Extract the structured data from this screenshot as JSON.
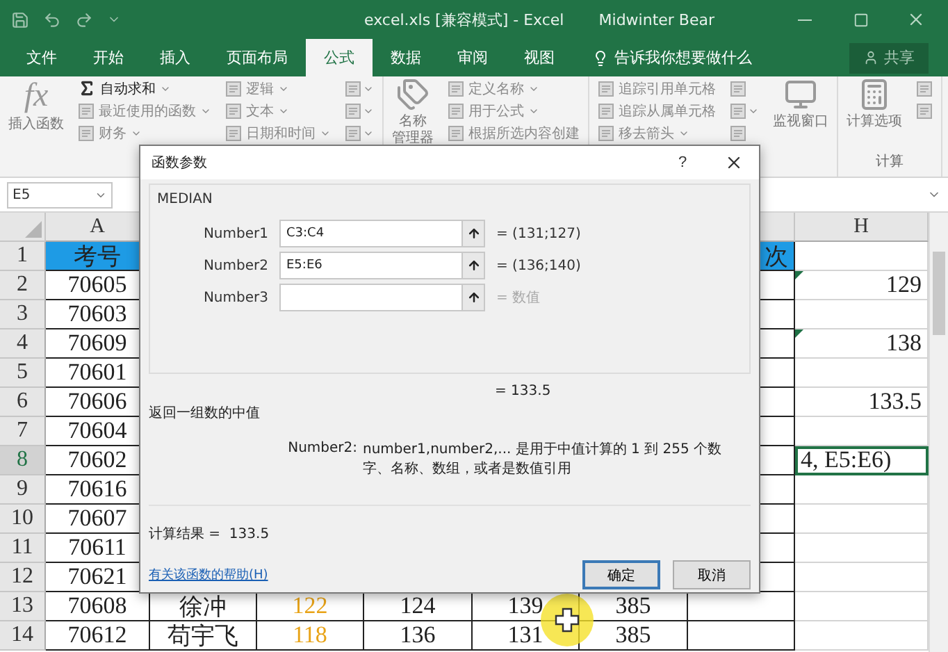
{
  "window": {
    "title": "excel.xls  [兼容模式]  -  Excel",
    "user": "Midwinter Bear"
  },
  "ribbon_tabs": [
    {
      "label": "文件",
      "selected": false
    },
    {
      "label": "开始",
      "selected": false
    },
    {
      "label": "插入",
      "selected": false
    },
    {
      "label": "页面布局",
      "selected": false
    },
    {
      "label": "公式",
      "selected": true
    },
    {
      "label": "数据",
      "selected": false
    },
    {
      "label": "审阅",
      "selected": false
    },
    {
      "label": "视图",
      "selected": false
    }
  ],
  "tell_me": "告诉我你想要做什么",
  "share_button": "共享",
  "ribbon_groups": [
    {
      "columns": [
        {
          "kind": "large",
          "glyph": "fx",
          "label": "插入函数"
        },
        {
          "kind": "stack",
          "items": [
            {
              "label": "自动求和",
              "dropdown": true,
              "disabled": false
            },
            {
              "label": "最近使用的函数",
              "dropdown": true,
              "disabled": true
            },
            {
              "label": "财务",
              "dropdown": true,
              "disabled": true
            }
          ]
        },
        {
          "kind": "stack",
          "items": [
            {
              "label": "逻辑",
              "dropdown": true,
              "disabled": true
            },
            {
              "label": "文本",
              "dropdown": true,
              "disabled": true
            },
            {
              "label": "日期和时间",
              "dropdown": true,
              "disabled": true
            }
          ]
        },
        {
          "kind": "icons",
          "items": [
            {
              "dropdown": true
            },
            {
              "dropdown": true
            },
            {
              "dropdown": true
            }
          ]
        }
      ]
    },
    {
      "columns": [
        {
          "kind": "large",
          "lines": [
            "名称",
            "管理器"
          ]
        },
        {
          "kind": "stack",
          "items": [
            {
              "label": "定义名称",
              "dropdown": true,
              "disabled": true
            },
            {
              "label": "用于公式",
              "dropdown": true,
              "disabled": true
            },
            {
              "label": "根据所选内容创建",
              "dropdown": false,
              "disabled": true
            }
          ]
        }
      ]
    },
    {
      "columns": [
        {
          "kind": "stack",
          "items": [
            {
              "label": "追踪引用单元格",
              "dropdown": false,
              "disabled": true
            },
            {
              "label": "追踪从属单元格",
              "dropdown": false,
              "disabled": true
            },
            {
              "label": "移去箭头",
              "dropdown": true,
              "disabled": true
            }
          ]
        },
        {
          "kind": "icons",
          "items": [
            {
              "dropdown": false
            },
            {
              "dropdown": true
            },
            {
              "dropdown": false
            }
          ]
        },
        {
          "kind": "large",
          "label": "监视窗口"
        }
      ]
    },
    {
      "label": "计算",
      "columns": [
        {
          "kind": "large",
          "label": "计算选项"
        },
        {
          "kind": "icons",
          "items": [
            {
              "dropdown": false
            },
            {
              "dropdown": false
            }
          ]
        }
      ]
    }
  ],
  "name_box": "E5",
  "column_headings": [
    "A",
    "H"
  ],
  "rows": [
    {
      "number": "1",
      "selected": false,
      "flag": false,
      "a": "考号",
      "g": "次"
    },
    {
      "number": "2",
      "selected": false,
      "flag": true,
      "a": "70605",
      "h": "129"
    },
    {
      "number": "3",
      "selected": false,
      "flag": false,
      "a": "70603"
    },
    {
      "number": "4",
      "selected": false,
      "flag": true,
      "a": "70609",
      "h": "138"
    },
    {
      "number": "5",
      "selected": false,
      "flag": false,
      "a": "70601"
    },
    {
      "number": "6",
      "selected": false,
      "flag": false,
      "a": "70606",
      "h": "133.5"
    },
    {
      "number": "7",
      "selected": false,
      "flag": false,
      "a": "70604"
    },
    {
      "number": "8",
      "selected": true,
      "flag": false,
      "a": "70602",
      "h": "4, E5:E6)"
    },
    {
      "number": "9",
      "selected": false,
      "flag": false,
      "a": "70616"
    },
    {
      "number": "10",
      "selected": false,
      "flag": false,
      "a": "70607"
    },
    {
      "number": "11",
      "selected": false,
      "flag": false,
      "a": "70611"
    },
    {
      "number": "12",
      "selected": false,
      "flag": false,
      "a": "70621"
    },
    {
      "number": "13",
      "selected": false,
      "flag": false,
      "a": "70608",
      "b": "徐冲",
      "c": "122",
      "d": "124",
      "e": "139",
      "f": "385"
    },
    {
      "number": "14",
      "selected": false,
      "flag": false,
      "a": "70612",
      "b": "苟宇飞",
      "c": "118",
      "d": "136",
      "e": "131",
      "f": "385"
    }
  ],
  "dialog": {
    "title": "函数参数",
    "help": "?",
    "function_name": "MEDIAN",
    "args": [
      {
        "label": "Number1",
        "value": "C3:C4",
        "result": "= (131;127)",
        "hint": false
      },
      {
        "label": "Number2",
        "value": "E5:E6",
        "result": "= (136;140)",
        "hint": false
      },
      {
        "label": "Number3",
        "result": "= 数值",
        "hint": true
      }
    ],
    "formula_result": "= 133.5",
    "description": "返回一组数的中值",
    "arg_help_label": "Number2:",
    "arg_help_text": "number1,number2,... 是用于中值计算的 1 到 255 个数字、名称、数组，或者是数值引用",
    "calc_result_label": "计算结果 =",
    "calc_result": "133.5",
    "help_link": "有关该函数的帮助(H)",
    "buttons": [
      {
        "label": "确定",
        "default": true
      },
      {
        "label": "取消",
        "default": false
      }
    ]
  }
}
